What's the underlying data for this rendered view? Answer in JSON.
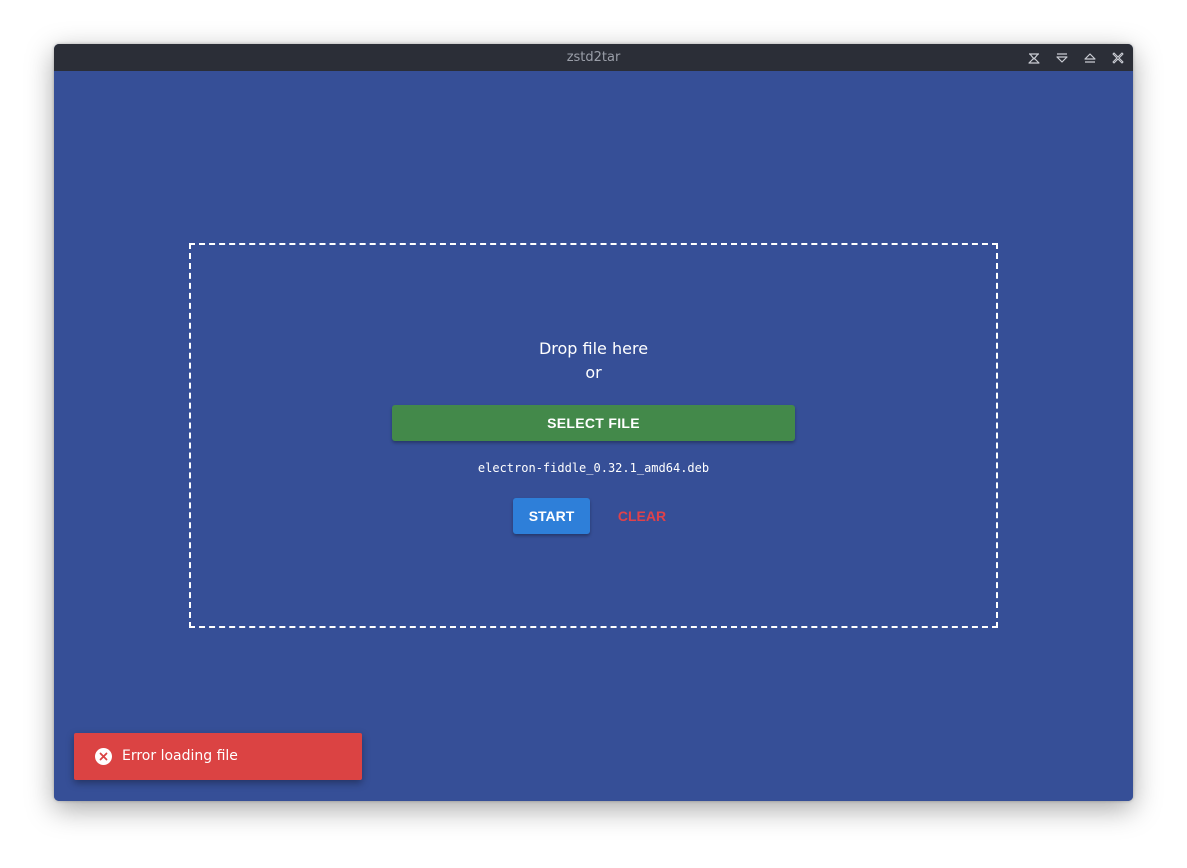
{
  "window": {
    "title": "zstd2tar",
    "controls": [
      {
        "name": "keep-above-icon"
      },
      {
        "name": "minimize-icon"
      },
      {
        "name": "maximize-icon"
      },
      {
        "name": "close-icon"
      }
    ]
  },
  "dropzone": {
    "drop_label": "Drop file here",
    "or_label": "or",
    "select_button": "SELECT FILE",
    "filename": "electron-fiddle_0.32.1_amd64.deb",
    "start_button": "START",
    "clear_button": "CLEAR"
  },
  "toast": {
    "icon": "error-circle-icon",
    "message": "Error loading file"
  },
  "colors": {
    "background": "#364f97",
    "titlebar": "#2b2e37",
    "select_button": "#43894a",
    "start_button": "#2e7fd9",
    "clear_text": "#e0414a",
    "toast": "#db4343"
  }
}
